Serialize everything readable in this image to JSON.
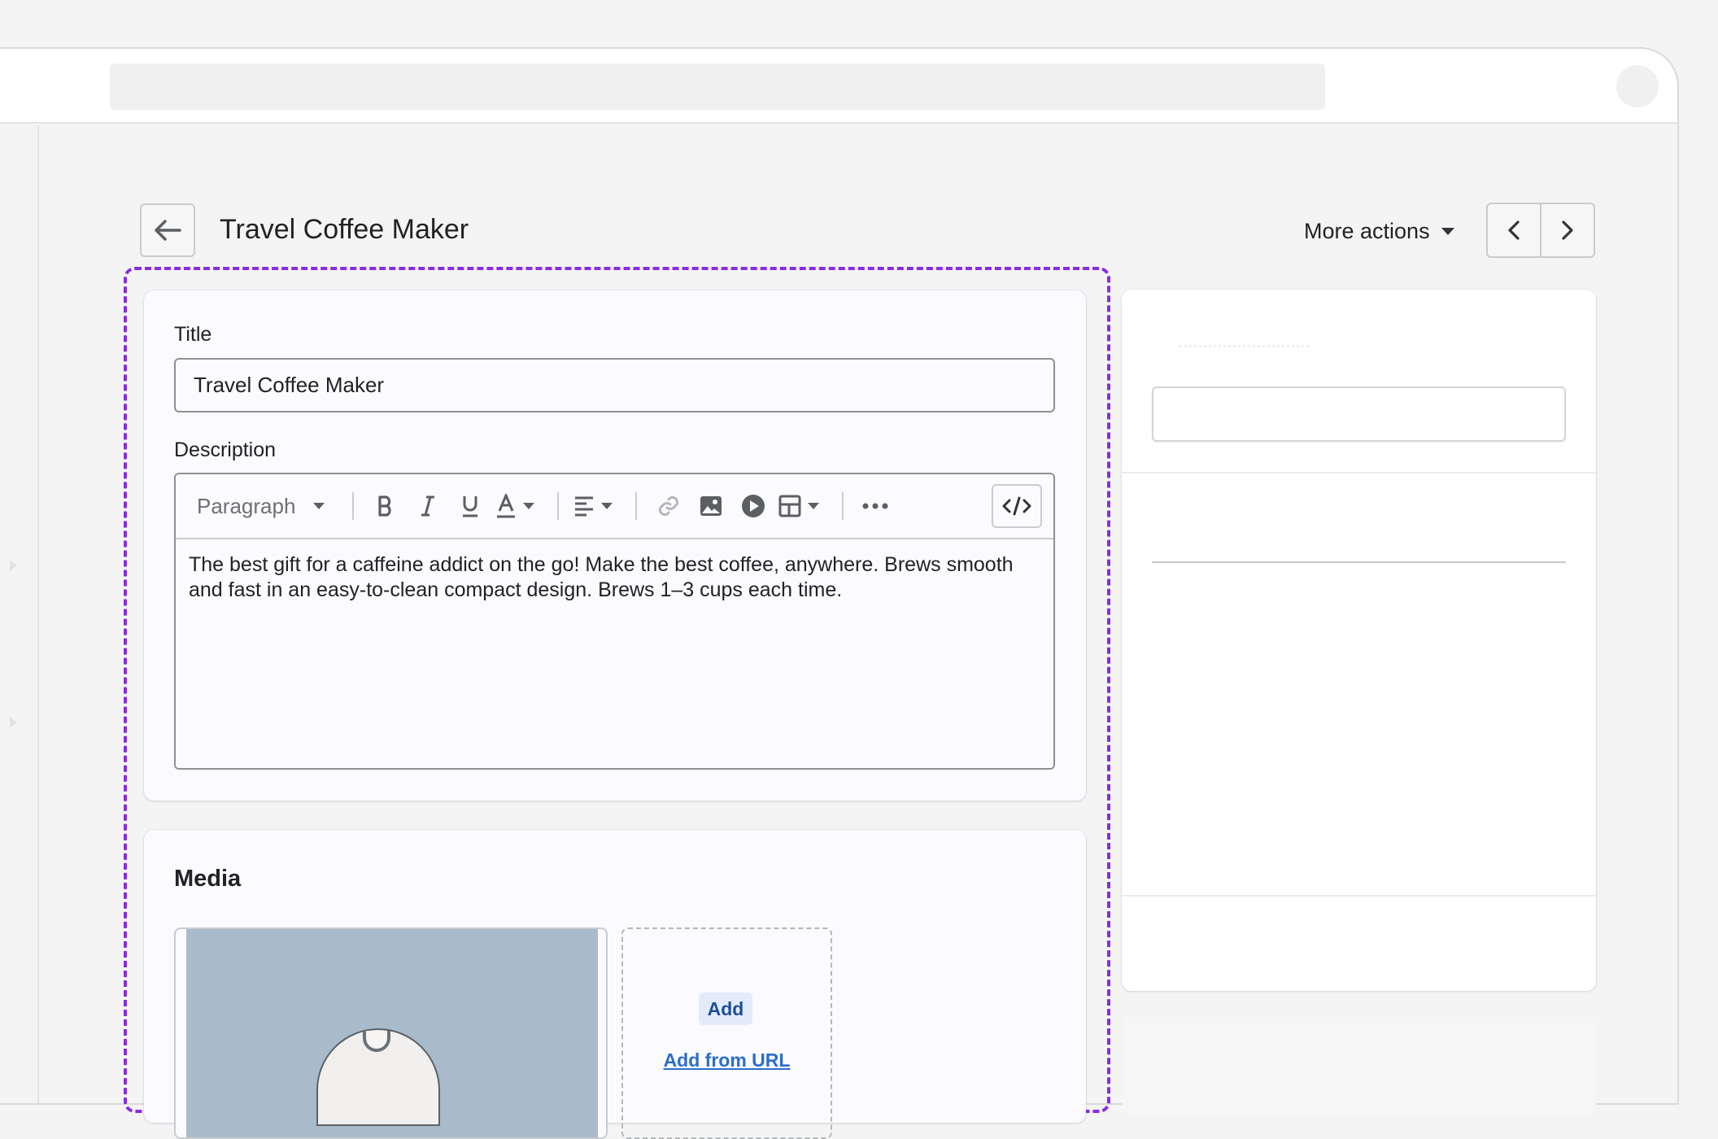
{
  "header": {
    "page_title": "Travel Coffee Maker",
    "more_actions_label": "More actions"
  },
  "product": {
    "title_label": "Title",
    "title_value": "Travel Coffee Maker",
    "description_label": "Description",
    "description_text": "The best gift for a caffeine addict on the go! Make the best coffee, anywhere. Brews smooth and fast in an easy-to-clean compact design. Brews 1–3 cups each time."
  },
  "editor_toolbar": {
    "format_select": "Paragraph",
    "buttons": [
      "bold-icon",
      "italic-icon",
      "underline-icon",
      "text-color-icon",
      "align-icon",
      "link-icon",
      "image-icon",
      "video-icon",
      "table-icon",
      "more-icon",
      "code-view-icon"
    ]
  },
  "media": {
    "title": "Media",
    "add_label": "Add",
    "add_from_url_label": "Add from URL"
  },
  "colors": {
    "focus_outline": "#8a2be2",
    "link": "#2c6ecb",
    "add_button_bg": "#e3ebfb"
  }
}
